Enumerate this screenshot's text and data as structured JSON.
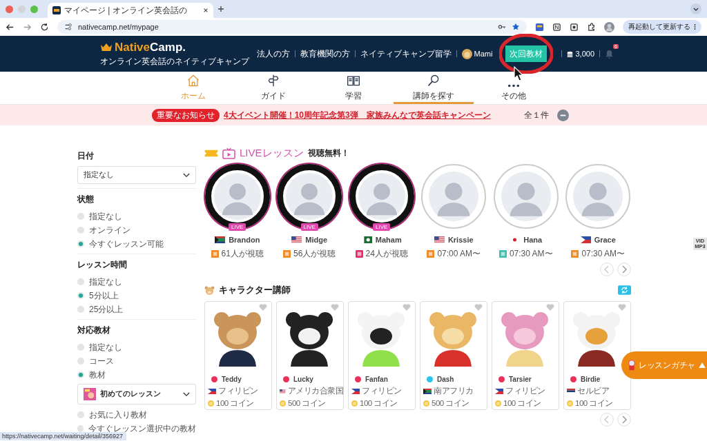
{
  "browser": {
    "tab_title": "マイページ | オンライン英会話の",
    "url": "nativecamp.net/mypage",
    "update_button": "再起動して更新する"
  },
  "header": {
    "logo_main": "Native",
    "logo_suffix": "Camp.",
    "tagline": "オンライン英会話のネイティブキャンプ",
    "links": [
      "法人の方",
      "教育機関の方",
      "ネイティブキャンプ留学"
    ],
    "user_name": "Mami",
    "next_button": "次回教材",
    "coins": "3,000",
    "notification_count": "6"
  },
  "nav": [
    {
      "label": "ホーム",
      "selected": true,
      "underlined": false
    },
    {
      "label": "ガイド",
      "selected": false,
      "underlined": false
    },
    {
      "label": "学習",
      "selected": false,
      "underlined": false
    },
    {
      "label": "講師を探す",
      "selected": false,
      "underlined": true
    },
    {
      "label": "その他",
      "selected": false,
      "underlined": false
    }
  ],
  "notice": {
    "badge": "重要なお知らせ",
    "text": "4大イベント開催！10周年記念第3弾　家族みんなで英会話キャンペーン",
    "count": "全１件"
  },
  "filters": [
    {
      "title": "日付",
      "items": [
        {
          "kind": "select",
          "label": "指定なし"
        }
      ]
    },
    {
      "title": "状態",
      "items": [
        {
          "kind": "radio",
          "label": "指定なし",
          "selected": false
        },
        {
          "kind": "radio",
          "label": "オンライン",
          "selected": false
        },
        {
          "kind": "radio",
          "label": "今すぐレッスン可能",
          "selected": true
        }
      ]
    },
    {
      "title": "レッスン時間",
      "items": [
        {
          "kind": "radio",
          "label": "指定なし",
          "selected": false
        },
        {
          "kind": "radio",
          "label": "5分以上",
          "selected": true
        },
        {
          "kind": "radio",
          "label": "25分以上",
          "selected": false
        }
      ]
    },
    {
      "title": "対応教材",
      "items": [
        {
          "kind": "radio",
          "label": "指定なし",
          "selected": false
        },
        {
          "kind": "radio",
          "label": "コース",
          "selected": false
        },
        {
          "kind": "radio",
          "label": "教材",
          "selected": true
        },
        {
          "kind": "material",
          "label": "初めてのレッスン"
        },
        {
          "kind": "radio",
          "label": "お気に入り教材",
          "selected": false
        },
        {
          "kind": "radio",
          "label": "今すぐレッスン選択中の教材",
          "selected": false
        }
      ]
    }
  ],
  "live": {
    "title": "LIVEレッスン",
    "subtitle": "視聴無料！",
    "teachers": [
      {
        "name": "Brandon",
        "live": true,
        "live_badge": "LIVE",
        "info": "61人が視聴",
        "color": "#f08a24"
      },
      {
        "name": "Midge",
        "live": true,
        "live_badge": "LIVE",
        "info": "56人が視聴",
        "color": "#f08a24"
      },
      {
        "name": "Maham",
        "live": true,
        "live_badge": "LIVE",
        "info": "24人が視聴",
        "color": "#e0336b"
      },
      {
        "name": "Krissie",
        "live": false,
        "info": "07:00 AM〜",
        "color": "#f08a24"
      },
      {
        "name": "Hana",
        "live": false,
        "info": "07:30 AM〜",
        "color": "#3fbfb0"
      },
      {
        "name": "Grace",
        "live": false,
        "info": "07:30 AM〜",
        "color": "#f08a24"
      }
    ]
  },
  "characters": {
    "title": "キャラクター講師",
    "cards": [
      {
        "name": "Teddy",
        "color": "#e8325a",
        "country_name": "フィリピン",
        "price": "100 コイン"
      },
      {
        "name": "Lucky",
        "color": "#e8325a",
        "country_name": "アメリカ合衆国",
        "price": "500 コイン"
      },
      {
        "name": "Fanfan",
        "color": "#e8325a",
        "country_name": "フィリピン",
        "price": "100 コイン"
      },
      {
        "name": "Dash",
        "color": "#2bc4ea",
        "country_name": "南アフリカ",
        "price": "500 コイン"
      },
      {
        "name": "Tarsier",
        "color": "#e8325a",
        "country_name": "フィリピン",
        "price": "100 コイン"
      },
      {
        "name": "Birdie",
        "color": "#e8325a",
        "country_name": "セルビア",
        "price": "100 コイン"
      }
    ]
  },
  "side_badge": "VID MP3",
  "gacha": "レッスンガチャ",
  "status_url": "https://nativecamp.net/waiting/detail/356927"
}
